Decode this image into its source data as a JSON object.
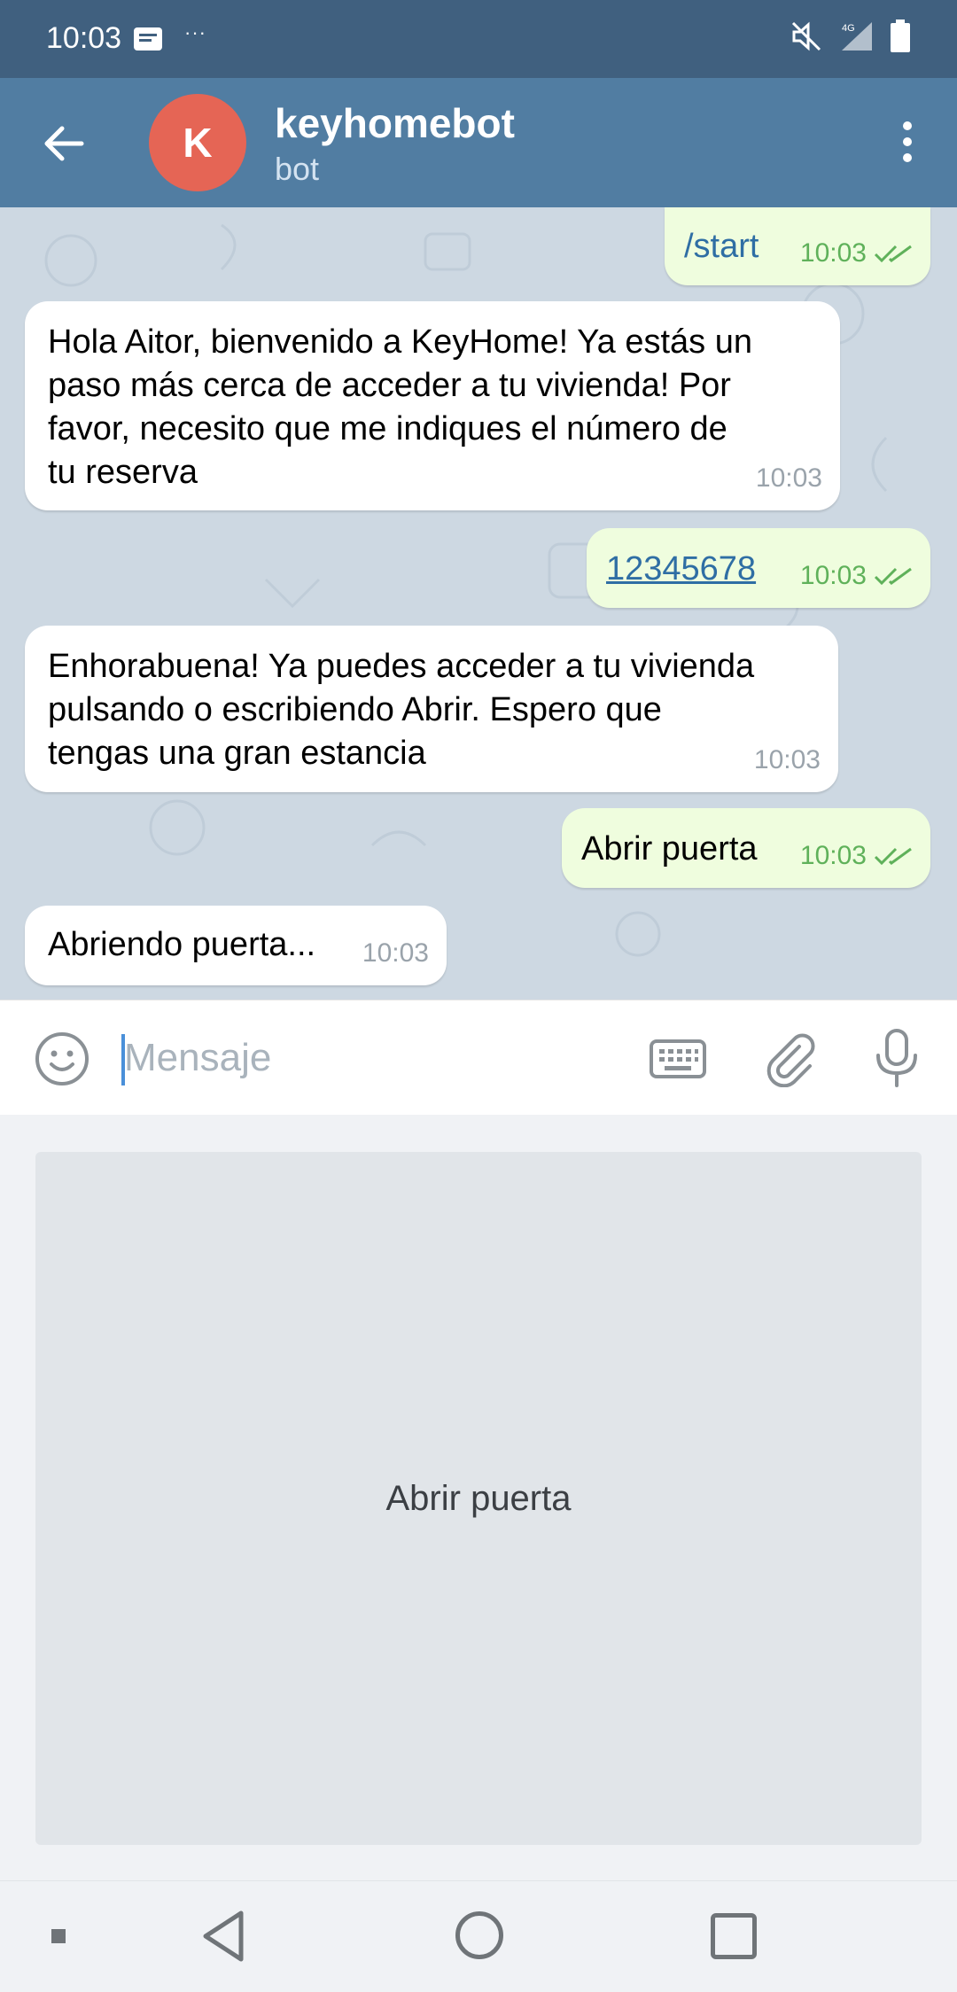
{
  "status_bar": {
    "time": "10:03",
    "network_label": "4G"
  },
  "header": {
    "avatar_letter": "K",
    "chat_name": "keyhomebot",
    "chat_status": "bot"
  },
  "messages": [
    {
      "direction": "out",
      "type": "command",
      "text": "/start",
      "time": "10:03",
      "read": true
    },
    {
      "direction": "in",
      "text": "Hola Aitor, bienvenido a KeyHome! Ya estás un\npaso más cerca de acceder a tu vivienda! Por\nfavor, necesito que me indiques el número de\ntu reserva",
      "time": "10:03"
    },
    {
      "direction": "out",
      "type": "link",
      "text": "12345678",
      "time": "10:03",
      "read": true
    },
    {
      "direction": "in",
      "text": "Enhorabuena! Ya puedes acceder a tu vivienda\npulsando o escribiendo Abrir. Espero que\ntengas una gran estancia",
      "time": "10:03"
    },
    {
      "direction": "out",
      "type": "text",
      "text": "Abrir puerta",
      "time": "10:03",
      "read": true
    },
    {
      "direction": "in",
      "text": "Abriendo puerta...",
      "time": "10:03"
    }
  ],
  "input": {
    "placeholder": "Mensaje",
    "value": ""
  },
  "bot_keyboard": {
    "buttons": [
      "Abrir puerta"
    ]
  },
  "colors": {
    "header": "#517da2",
    "status_bar": "#40607f",
    "outgoing_bubble": "#effdde",
    "incoming_bubble": "#ffffff",
    "read_check": "#5fb15a",
    "avatar": "#e56555"
  },
  "icons": [
    "back-arrow-icon",
    "more-vert-icon",
    "emoji-icon",
    "keyboard-icon",
    "attach-icon",
    "mic-icon",
    "double-check-icon",
    "notification-icon",
    "mute-icon",
    "signal-icon",
    "battery-icon"
  ]
}
